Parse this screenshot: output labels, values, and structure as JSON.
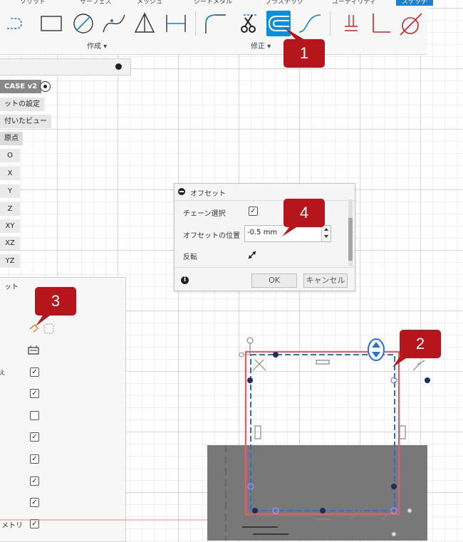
{
  "toolbar": {
    "tabs": [
      "ソリッド",
      "サーフェス",
      "メッシュ",
      "シートメタル",
      "プラスチック",
      "ユーティリティ",
      "スケッチ"
    ],
    "groups": {
      "create": "作成 ▾",
      "modify": "修正 ▾"
    },
    "icons": [
      "line-icon",
      "rectangle-icon",
      "circle-icon",
      "spline-icon",
      "triangle-icon",
      "dimension-icon",
      "fillet-icon",
      "trim-icon",
      "offset-icon",
      "curve-icon",
      "constraint-icon",
      "perpendicular-icon",
      "tangent-icon"
    ]
  },
  "browser": {
    "component": "CASE v2",
    "items": [
      "ットの設定",
      "付いたビュー",
      "原点"
    ],
    "axes": [
      "O",
      "X",
      "Y",
      "Z",
      "XY",
      "XZ",
      "YZ"
    ]
  },
  "sketch_panel": {
    "title": "ット",
    "last_row_label": "メトリ",
    "checkboxes": [
      true,
      true,
      false,
      true,
      true,
      true,
      true,
      true
    ]
  },
  "offset_dialog": {
    "title": "オフセット",
    "chain_select_label": "チェーン選択",
    "chain_select_checked": true,
    "offset_position_label": "オフセットの位置",
    "offset_position_value": "-0.5 mm",
    "flip_label": "反転",
    "ok_label": "OK",
    "cancel_label": "キャンセル"
  },
  "callouts": [
    "1",
    "2",
    "3",
    "4"
  ],
  "colors": {
    "accent": "#0a8fdc",
    "callout": "#b5151b",
    "profile": "#e46060",
    "offset": "#2d6fd8"
  }
}
